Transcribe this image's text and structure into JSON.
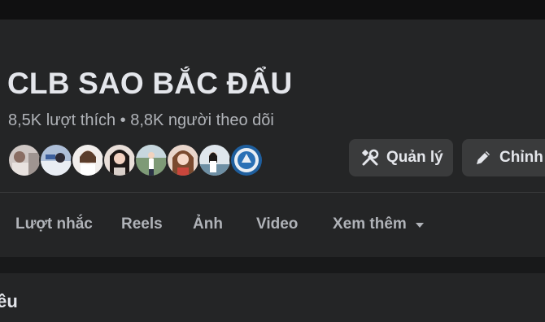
{
  "page": {
    "title": "CLB SAO BẮC ĐẨU",
    "stats": "8,5K lượt thích • 8,8K người theo dõi"
  },
  "followers": {
    "count_shown": 8
  },
  "actions": {
    "manage_label": "Quản lý",
    "manage_icon": "tools-icon",
    "edit_label": "Chỉnh",
    "edit_icon": "pencil-icon"
  },
  "tabs": [
    {
      "label": "Lượt nhắc"
    },
    {
      "label": "Reels"
    },
    {
      "label": "Ảnh"
    },
    {
      "label": "Video"
    },
    {
      "label": "Xem thêm",
      "icon": "caret-down-icon"
    }
  ],
  "intro": {
    "title": "iêu"
  },
  "colors": {
    "background": "#18191a",
    "card": "#242526",
    "button": "#3a3b3c",
    "text_primary": "#e4e6eb",
    "text_secondary": "#b0b3b8"
  }
}
